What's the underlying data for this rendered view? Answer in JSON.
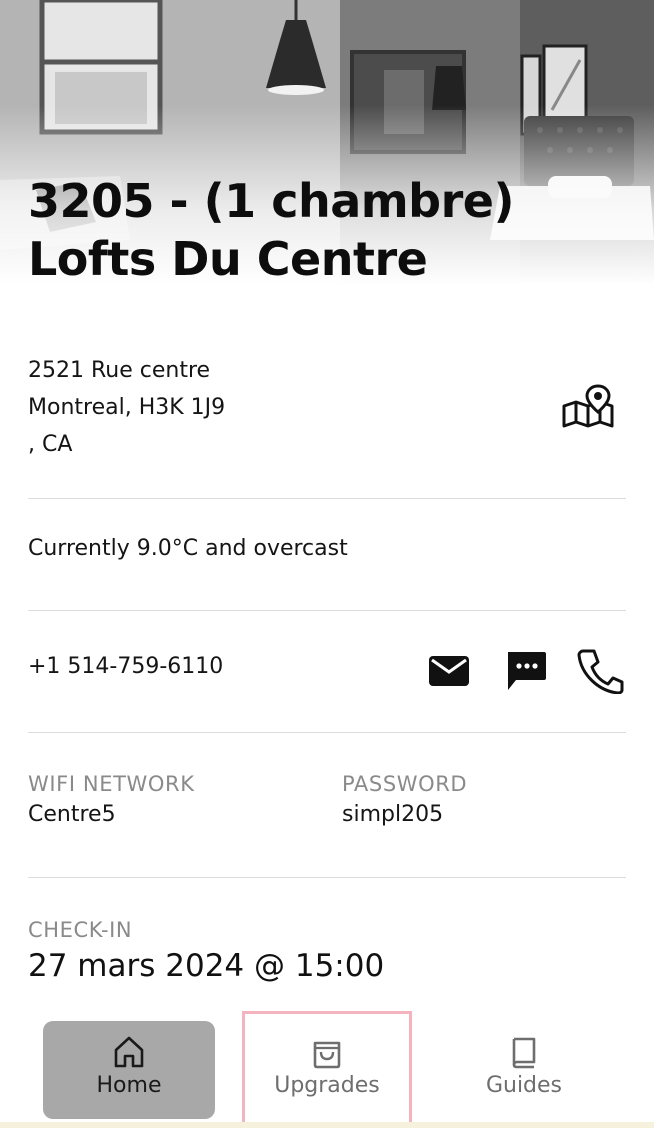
{
  "property": {
    "title_line1": "3205 - (1 chambre)",
    "title_line2": "Lofts Du Centre"
  },
  "address": {
    "line1": "2521 Rue centre",
    "line2": "Montreal, H3K 1J9",
    "line3": ", CA",
    "icon": "map-pin-icon"
  },
  "weather": {
    "text": "Currently 9.0°C and overcast"
  },
  "contact": {
    "phone": "+1 514-759-6110",
    "icons": [
      "mail-icon",
      "chat-icon",
      "phone-icon"
    ]
  },
  "wifi": {
    "network_label": "WIFI NETWORK",
    "network_value": "Centre5",
    "password_label": "PASSWORD",
    "password_value": "simpl205"
  },
  "checkin": {
    "label": "CHECK-IN",
    "value": "27 mars 2024 @ 15:00"
  },
  "nav": {
    "items": [
      {
        "label": "Home",
        "icon": "home-icon",
        "active": true
      },
      {
        "label": "Upgrades",
        "icon": "shopping-bag-icon",
        "active": false
      },
      {
        "label": "Guides",
        "icon": "book-icon",
        "active": false
      }
    ]
  },
  "colors": {
    "active_nav_bg": "#a8a8a8",
    "highlight_border": "#f3b4c0",
    "label_gray": "#8a8a8a"
  }
}
